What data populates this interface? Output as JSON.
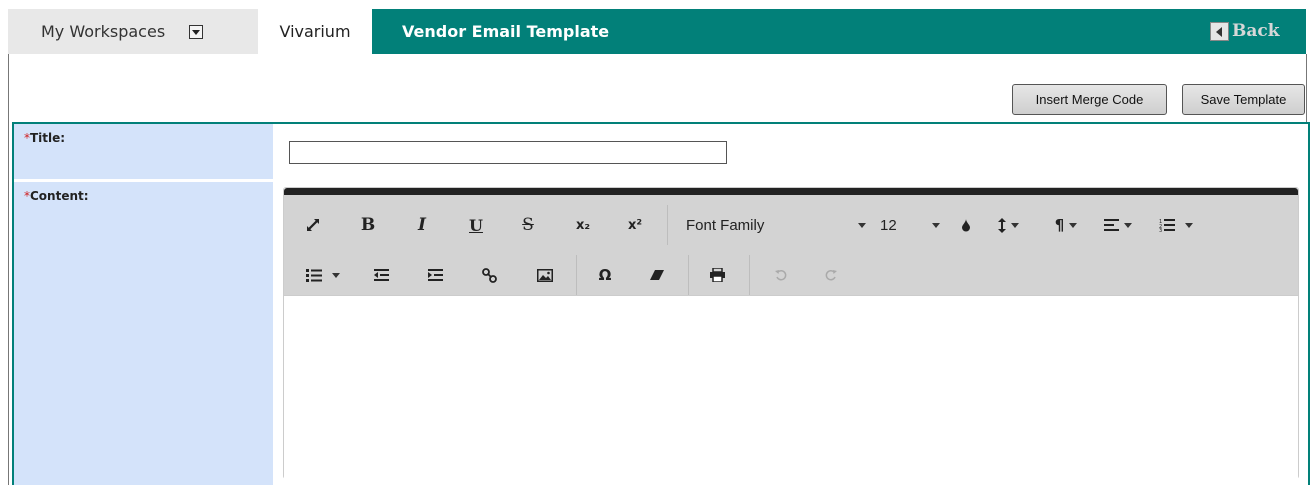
{
  "nav": {
    "workspaces_label": "My Workspaces",
    "active_tab_label": "Vivarium",
    "page_title": "Vendor Email Template",
    "back_label": "Back"
  },
  "actions": {
    "insert_merge_label": "Insert Merge Code",
    "save_label": "Save Template"
  },
  "form": {
    "title_label": "Title:",
    "content_label": "Content:",
    "required_mark": "*",
    "title_value": ""
  },
  "editor": {
    "font_family_label": "Font Family",
    "font_size_value": "12",
    "bold": "B",
    "italic": "I",
    "underline": "U",
    "strike": "S",
    "subscript": "x₂",
    "superscript": "x²",
    "special_char": "Ω",
    "content": ""
  },
  "colors": {
    "accent": "#028079",
    "label_bg": "#d4e3fa",
    "toolbar_bg": "#d3d3d3"
  }
}
